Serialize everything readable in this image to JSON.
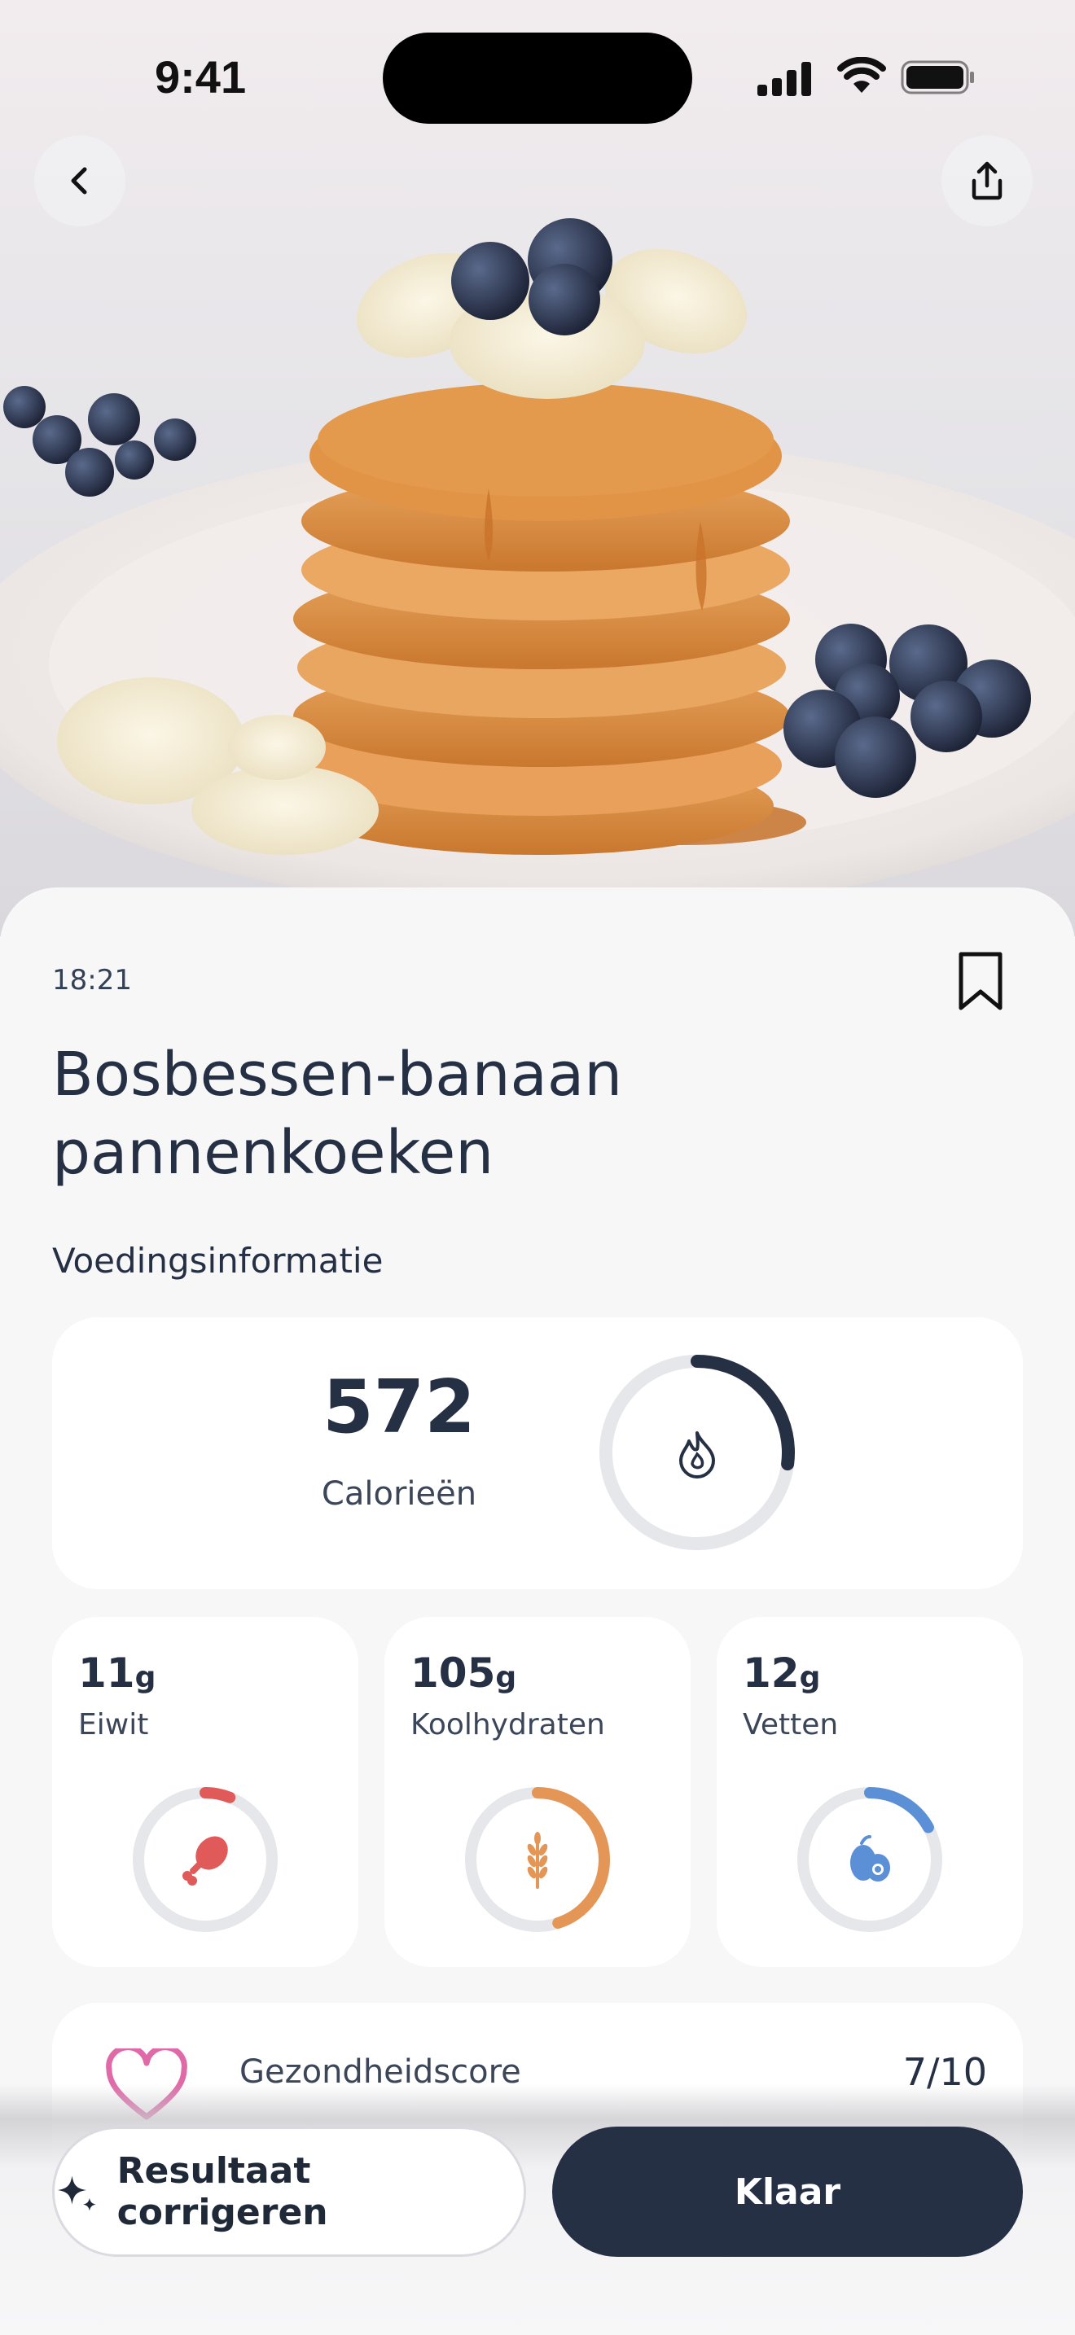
{
  "status_bar": {
    "time": "9:41"
  },
  "header": {
    "back_icon": "chevron-left-icon",
    "share_icon": "share-icon"
  },
  "meal": {
    "time": "18:21",
    "title": "Bosbessen-banaan pannenkoeken",
    "bookmark_icon": "bookmark-icon"
  },
  "nutrition": {
    "section_label": "Voedingsinformatie",
    "calories": {
      "value": "572",
      "label": "Calorieën",
      "progress": 0.27,
      "icon": "flame-icon",
      "color": "#253044"
    },
    "macros": [
      {
        "value": "11",
        "unit": "g",
        "label": "Eiwit",
        "progress": 0.06,
        "icon": "drumstick-icon",
        "color": "#e05a5a"
      },
      {
        "value": "105",
        "unit": "g",
        "label": "Koolhydraten",
        "progress": 0.45,
        "icon": "wheat-icon",
        "color": "#e39656"
      },
      {
        "value": "12",
        "unit": "g",
        "label": "Vetten",
        "progress": 0.17,
        "icon": "avocado-icon",
        "color": "#5b8fd6"
      }
    ]
  },
  "health": {
    "label": "Gezondheidscore",
    "score": "7/10",
    "icon": "heart-icon",
    "color": "#e06aa8"
  },
  "actions": {
    "correct_label": "Resultaat corrigeren",
    "correct_icon": "sparkles-icon",
    "done_label": "Klaar"
  }
}
